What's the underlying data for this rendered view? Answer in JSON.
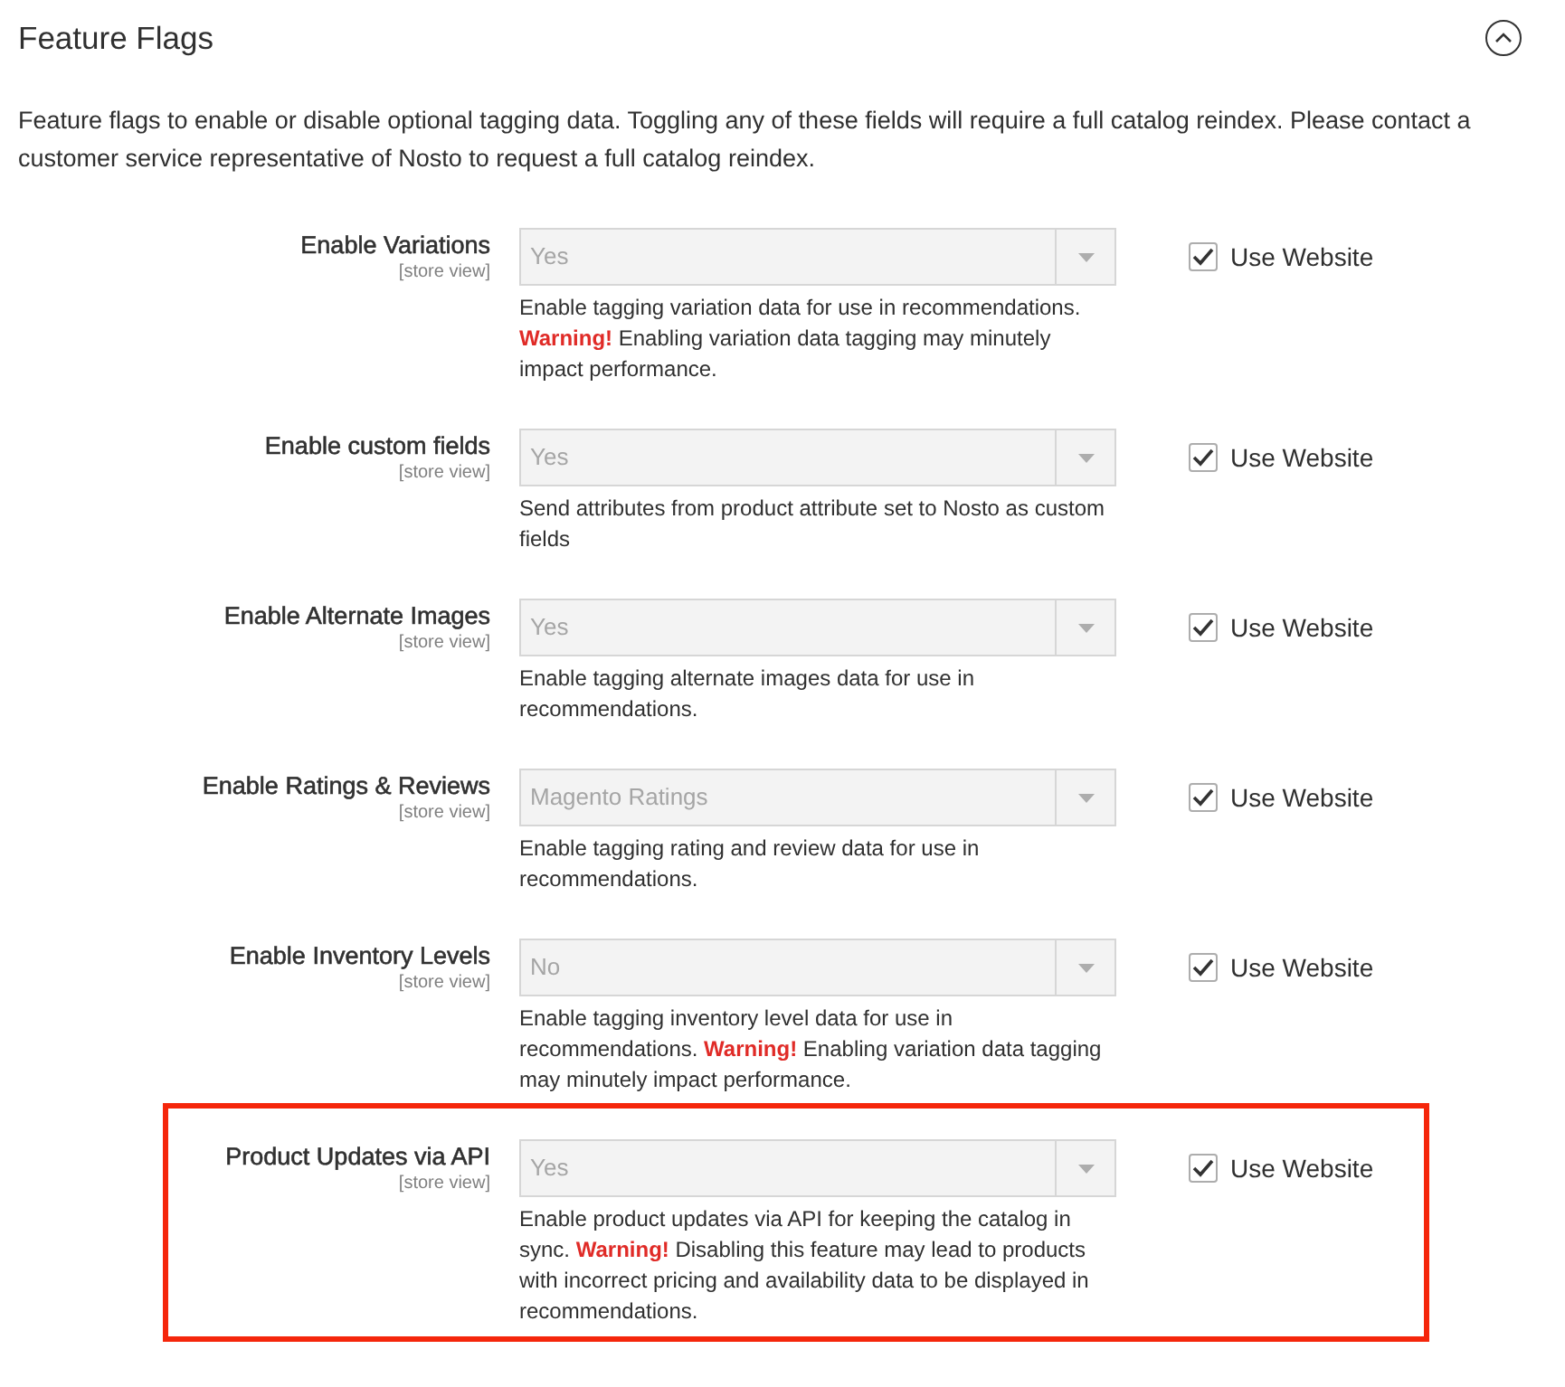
{
  "section": {
    "title": "Feature Flags",
    "expanded": true,
    "description": "Feature flags to enable or disable optional tagging data. Toggling any of these fields will require a full catalog reindex. Please contact a customer service representative of Nosto to request a full catalog reindex."
  },
  "rows": [
    {
      "label": "Enable Variations",
      "scope": "[store view]",
      "value": "Yes",
      "note": "Enable tagging variation data for use in recommendations. **Warning!** Enabling variation data tagging may minutely impact performance.",
      "use_website": {
        "label": "Use Website",
        "checked": true
      },
      "highlighted": false
    },
    {
      "label": "Enable custom fields",
      "scope": "[store view]",
      "value": "Yes",
      "note": "Send attributes from product attribute set to Nosto as custom fields",
      "use_website": {
        "label": "Use Website",
        "checked": true
      },
      "highlighted": false
    },
    {
      "label": "Enable Alternate Images",
      "scope": "[store view]",
      "value": "Yes",
      "note": "Enable tagging alternate images data for use in recommendations.",
      "use_website": {
        "label": "Use Website",
        "checked": true
      },
      "highlighted": false
    },
    {
      "label": "Enable Ratings & Reviews",
      "scope": "[store view]",
      "value": "Magento Ratings",
      "note": "Enable tagging rating and review data for use in recommendations.",
      "use_website": {
        "label": "Use Website",
        "checked": true
      },
      "highlighted": false
    },
    {
      "label": "Enable Inventory Levels",
      "scope": "[store view]",
      "value": "No",
      "note": "Enable tagging inventory level data for use in recommendations. **Warning!** Enabling variation data tagging may minutely impact performance.",
      "use_website": {
        "label": "Use Website",
        "checked": true
      },
      "highlighted": false
    },
    {
      "label": "Product Updates via API",
      "scope": "[store view]",
      "value": "Yes",
      "note": "Enable product updates via API for keeping the catalog in sync. **Warning!** Disabling this feature may lead to products with incorrect pricing and availability data to be displayed in recommendations.",
      "use_website": {
        "label": "Use Website",
        "checked": true
      },
      "highlighted": true
    }
  ]
}
